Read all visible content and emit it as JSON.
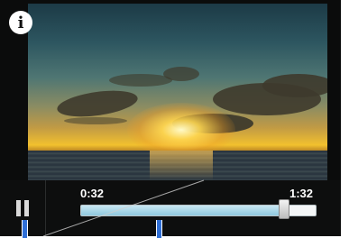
{
  "player": {
    "info_icon": "info-icon",
    "pause_icon": "pause-icon",
    "time_current": "0:32",
    "time_total": "1:32",
    "progress_fraction": 0.8
  },
  "colors": {
    "control_bar": "#0d0e0e",
    "track_fill": "#8fc8de",
    "marker": "#2f6fd6"
  }
}
